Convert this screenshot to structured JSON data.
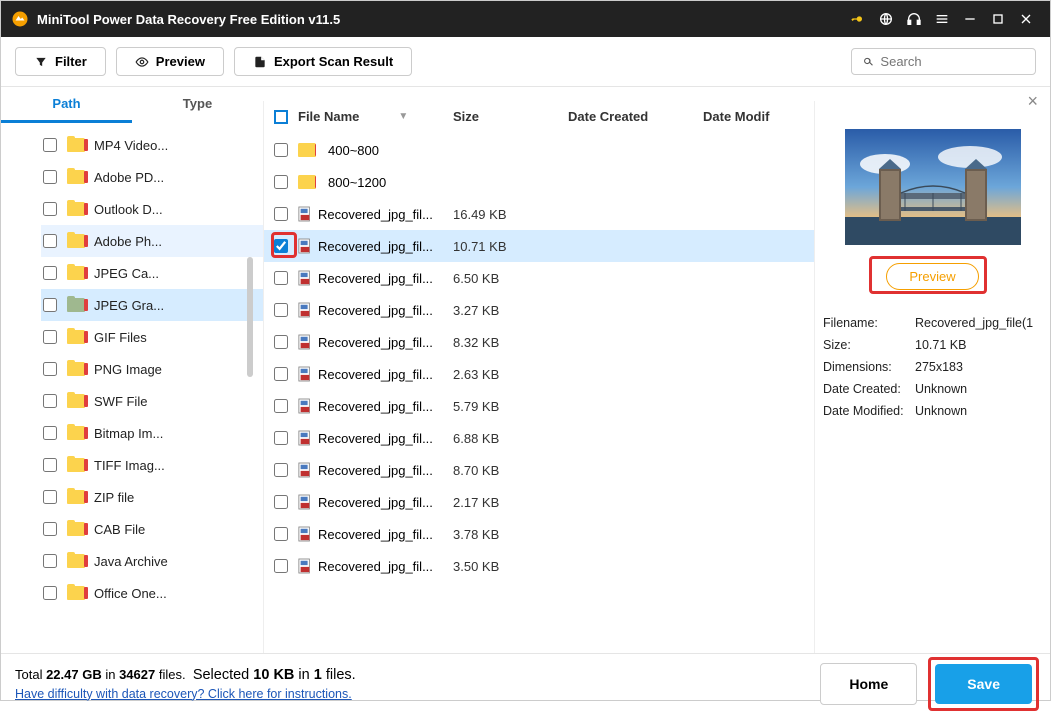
{
  "window": {
    "title": "MiniTool Power Data Recovery Free Edition v11.5"
  },
  "toolbar": {
    "filter": "Filter",
    "preview": "Preview",
    "export": "Export Scan Result",
    "search_placeholder": "Search"
  },
  "left": {
    "tabs": {
      "path": "Path",
      "type": "Type"
    },
    "items": [
      {
        "label": "MP4 Video...",
        "green": false
      },
      {
        "label": "Adobe PD...",
        "green": false
      },
      {
        "label": "Outlook D...",
        "green": false
      },
      {
        "label": "Adobe Ph...",
        "green": false,
        "highlighted": true
      },
      {
        "label": "JPEG Ca...",
        "green": false
      },
      {
        "label": "JPEG Gra...",
        "green": true,
        "selected": true,
        "expander": ">"
      },
      {
        "label": "GIF Files",
        "green": false
      },
      {
        "label": "PNG Image",
        "green": false,
        "expander": ">"
      },
      {
        "label": "SWF File",
        "green": false
      },
      {
        "label": "Bitmap Im...",
        "green": false
      },
      {
        "label": "TIFF Imag...",
        "green": false
      },
      {
        "label": "ZIP file",
        "green": false
      },
      {
        "label": "CAB File",
        "green": false
      },
      {
        "label": "Java Archive",
        "green": false
      },
      {
        "label": "Office One...",
        "green": false
      }
    ]
  },
  "files": {
    "header": {
      "name": "File Name",
      "size": "Size",
      "created": "Date Created",
      "modified": "Date Modif"
    },
    "rows": [
      {
        "type": "folder",
        "name": "400~800",
        "size": "",
        "checked": false
      },
      {
        "type": "folder",
        "name": "800~1200",
        "size": "",
        "checked": false
      },
      {
        "type": "file",
        "name": "Recovered_jpg_fil...",
        "size": "16.49 KB",
        "checked": false
      },
      {
        "type": "file",
        "name": "Recovered_jpg_fil...",
        "size": "10.71 KB",
        "checked": true,
        "selected": true
      },
      {
        "type": "file",
        "name": "Recovered_jpg_fil...",
        "size": "6.50 KB",
        "checked": false
      },
      {
        "type": "file",
        "name": "Recovered_jpg_fil...",
        "size": "3.27 KB",
        "checked": false
      },
      {
        "type": "file",
        "name": "Recovered_jpg_fil...",
        "size": "8.32 KB",
        "checked": false
      },
      {
        "type": "file",
        "name": "Recovered_jpg_fil...",
        "size": "2.63 KB",
        "checked": false
      },
      {
        "type": "file",
        "name": "Recovered_jpg_fil...",
        "size": "5.79 KB",
        "checked": false
      },
      {
        "type": "file",
        "name": "Recovered_jpg_fil...",
        "size": "6.88 KB",
        "checked": false
      },
      {
        "type": "file",
        "name": "Recovered_jpg_fil...",
        "size": "8.70 KB",
        "checked": false
      },
      {
        "type": "file",
        "name": "Recovered_jpg_fil...",
        "size": "2.17 KB",
        "checked": false
      },
      {
        "type": "file",
        "name": "Recovered_jpg_fil...",
        "size": "3.78 KB",
        "checked": false
      },
      {
        "type": "file",
        "name": "Recovered_jpg_fil...",
        "size": "3.50 KB",
        "checked": false
      }
    ]
  },
  "preview": {
    "button": "Preview",
    "meta": {
      "filename_k": "Filename:",
      "filename_v": "Recovered_jpg_file(1",
      "size_k": "Size:",
      "size_v": "10.71 KB",
      "dim_k": "Dimensions:",
      "dim_v": "275x183",
      "created_k": "Date Created:",
      "created_v": "Unknown",
      "modified_k": "Date Modified:",
      "modified_v": "Unknown"
    }
  },
  "footer": {
    "total_a": "Total ",
    "total_b": "22.47 GB",
    "total_c": " in ",
    "total_d": "34627",
    "total_e": " files.",
    "sel_a": "Selected ",
    "sel_b": "10 KB",
    "sel_c": " in ",
    "sel_d": "1",
    "sel_e": " files.",
    "help": "Have difficulty with data recovery? Click here for instructions.",
    "home": "Home",
    "save": "Save"
  }
}
